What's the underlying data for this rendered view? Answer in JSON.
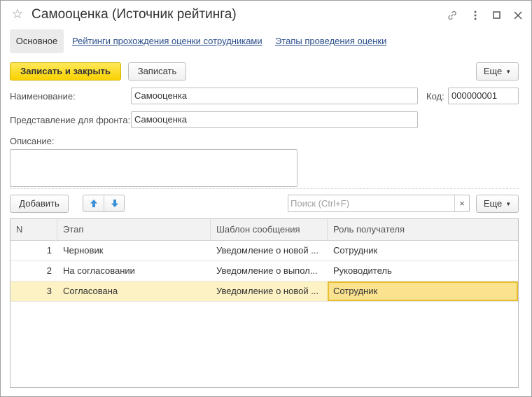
{
  "window": {
    "title": "Самооценка (Источник рейтинга)",
    "icons": [
      "star-icon",
      "link-icon",
      "more-vertical-icon",
      "maximize-icon",
      "close-icon"
    ]
  },
  "tabs": [
    {
      "label": "Основное",
      "active": true
    },
    {
      "label": "Рейтинги прохождения оценки сотрудниками",
      "active": false
    },
    {
      "label": "Этапы проведения оценки",
      "active": false
    }
  ],
  "toolbar": {
    "save_close": "Записать и закрыть",
    "save": "Записать",
    "more": "Еще"
  },
  "form": {
    "name_label": "Наименование:",
    "name_value": "Самооценка",
    "code_label": "Код:",
    "code_value": "000000001",
    "front_label": "Представление для фронта:",
    "front_value": "Самооценка",
    "description_label": "Описание:",
    "description_value": ""
  },
  "table_toolbar": {
    "add": "Добавить",
    "search_placeholder": "Поиск (Ctrl+F)",
    "clear": "×",
    "more": "Еще"
  },
  "table": {
    "columns": [
      "N",
      "Этап",
      "Шаблон сообщения",
      "Роль получателя"
    ],
    "rows": [
      {
        "n": "1",
        "stage": "Черновик",
        "template": "Уведомление о новой ...",
        "role": "Сотрудник"
      },
      {
        "n": "2",
        "stage": "На согласовании",
        "template": "Уведомление о выпол...",
        "role": "Руководитель"
      },
      {
        "n": "3",
        "stage": "Согласована",
        "template": "Уведомление о новой ...",
        "role": "Сотрудник",
        "selected": true
      }
    ]
  },
  "colors": {
    "accent_yellow": "#f9d100",
    "link": "#2a4e8a",
    "selected_row": "#fdf2c4",
    "focused_cell": "#fbe28f",
    "arrow_icons": "#3b8fd6"
  }
}
